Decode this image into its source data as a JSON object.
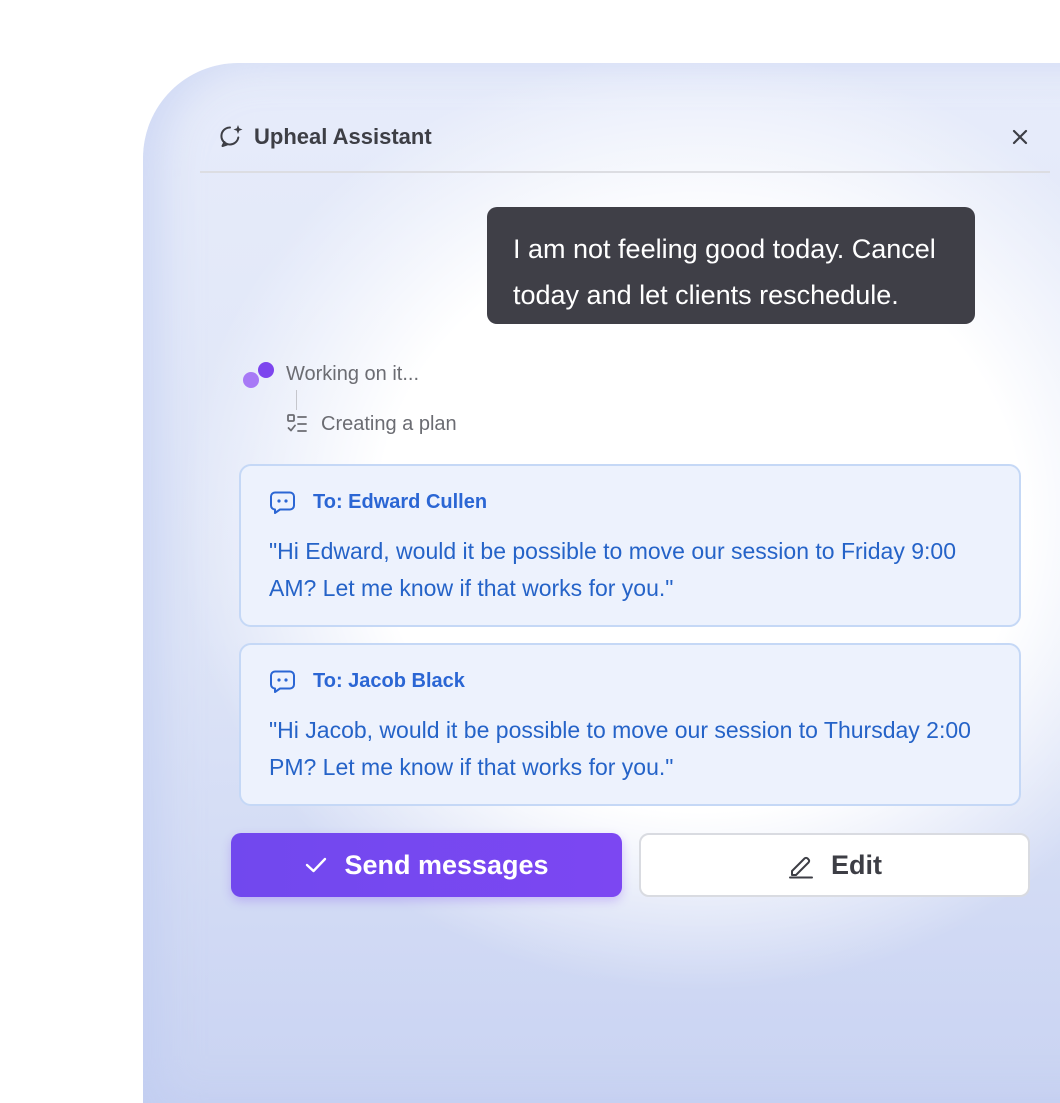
{
  "header": {
    "title": "Upheal Assistant",
    "icon": "sparkle-chat-icon",
    "close_icon": "close-icon"
  },
  "conversation": {
    "user_message": "I am not feeling good today. Cancel today and let clients reschedule."
  },
  "status": {
    "working_text": "Working on it...",
    "step_text": "Creating a plan"
  },
  "messages": [
    {
      "to": "To: Edward Cullen",
      "body": "\"Hi Edward, would it be possible to move our session to Friday 9:00 AM? Let me know if that works for you.\""
    },
    {
      "to": "To: Jacob Black",
      "body": "\"Hi Jacob, would it be possible to move our session to Thursday 2:00 PM? Let me know if that works for you.\""
    }
  ],
  "actions": {
    "send_label": "Send messages",
    "edit_label": "Edit"
  },
  "colors": {
    "accent": "#7C47F2",
    "message_text": "#2563C8",
    "bubble_bg": "#3F3F47"
  }
}
